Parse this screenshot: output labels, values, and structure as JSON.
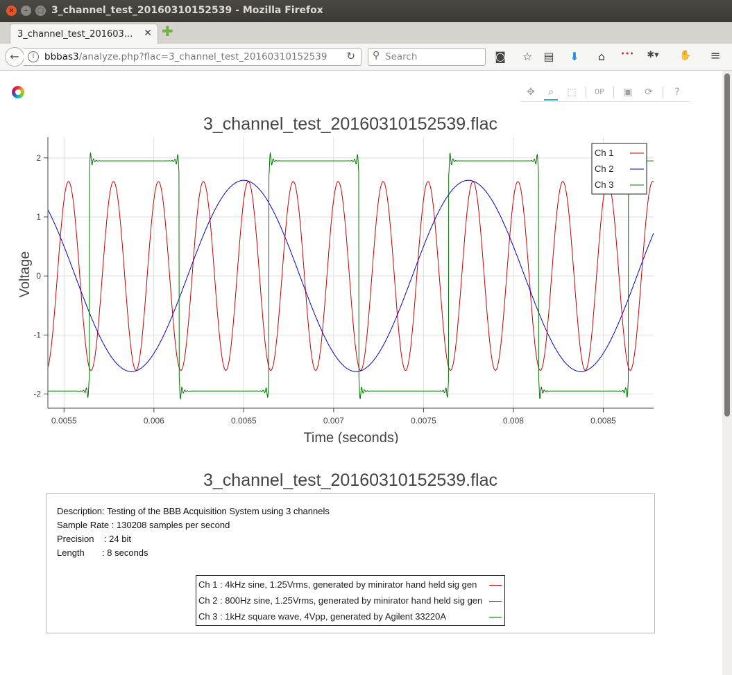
{
  "window": {
    "title": "3_channel_test_20160310152539 - Mozilla Firefox"
  },
  "tab": {
    "label": "3_channel_test_201603...",
    "close": "✕"
  },
  "nav": {
    "url_host": "bbbas3",
    "url_path": "/analyze.php?flac=3_channel_test_20160310152539",
    "search_placeholder": "Search"
  },
  "toolbar_icons": [
    "pocket-icon",
    "bookmark-star-icon",
    "reading-list-icon",
    "downloads-icon",
    "home-icon",
    "extension-icon",
    "menu-icon"
  ],
  "bokeh_tools": [
    "pan-icon",
    "box-zoom-icon",
    "resize-icon",
    "wheel-zoom-icon",
    "save-icon",
    "reset-icon",
    "help-icon"
  ],
  "plot_title": "3_channel_test_20160310152539.flac",
  "info_title": "3_channel_test_20160310152539.flac",
  "chart_data": {
    "type": "line",
    "title": "3_channel_test_20160310152539.flac",
    "xlabel": "Time (seconds)",
    "ylabel": "Voltage",
    "xlim": [
      0.00541,
      0.00878
    ],
    "ylim": [
      -2.24,
      2.35
    ],
    "xticks": [
      0.0055,
      0.006,
      0.0065,
      0.007,
      0.0075,
      0.008,
      0.0085
    ],
    "xtick_labels": [
      "0.0055",
      "0.006",
      "0.0065",
      "0.007",
      "0.0075",
      "0.008",
      "0.0085"
    ],
    "yticks": [
      -2,
      -1,
      0,
      1,
      2
    ],
    "ytick_labels": [
      "-2",
      "-1",
      "0",
      "1",
      "2"
    ],
    "grid": true,
    "legend_position": "top-right",
    "series": [
      {
        "name": "Ch 1",
        "color": "#cc0000",
        "kind": "sine",
        "freq_hz": 4000,
        "amplitude": 1.6,
        "phase_ref_peak_x": 0.006025
      },
      {
        "name": "Ch 2",
        "color": "#0000cc",
        "kind": "sine",
        "freq_hz": 800,
        "amplitude": 1.62,
        "phase_ref_peak_x": 0.0065
      },
      {
        "name": "Ch 3",
        "color": "#007700",
        "kind": "square",
        "freq_hz": 1000,
        "high": 1.95,
        "low": -1.95,
        "rising_edges": [
          0.00564,
          0.00664,
          0.00764,
          0.00864
        ],
        "falling_edges": [
          0.00614,
          0.00714,
          0.00814
        ]
      }
    ]
  },
  "info": {
    "description": "Description: Testing of the BBB Acquisition System using 3 channels",
    "sample_rate": "Sample Rate : 130208 samples per second",
    "precision": "Precision    : 24 bit",
    "length": "Length       : 8 seconds"
  },
  "channel_legend": [
    {
      "label": "Ch 1 : 4kHz sine, 1.25Vrms, generated by minirator hand held sig gen",
      "color": "#cc0000"
    },
    {
      "label": "Ch 2 : 800Hz sine, 1.25Vrms, generated by minirator hand held sig gen",
      "color": "#0000cc"
    },
    {
      "label": "Ch 3 : 1kHz square wave, 4Vpp, generated by Agilent 33220A",
      "color": "#007700"
    }
  ]
}
